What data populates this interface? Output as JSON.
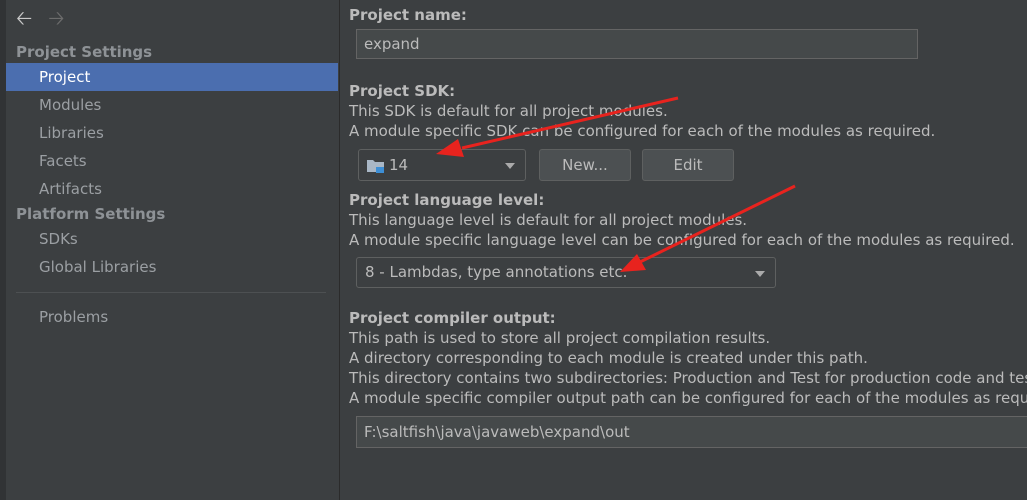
{
  "nav": {
    "back_icon": "arrow-left-icon",
    "forward_icon": "arrow-right-icon"
  },
  "sidebar": {
    "project_settings_header": "Project Settings",
    "platform_settings_header": "Platform Settings",
    "items": [
      {
        "label": "Project",
        "selected": true
      },
      {
        "label": "Modules"
      },
      {
        "label": "Libraries"
      },
      {
        "label": "Facets"
      },
      {
        "label": "Artifacts"
      },
      {
        "label": "SDKs"
      },
      {
        "label": "Global Libraries"
      },
      {
        "label": "Problems"
      }
    ]
  },
  "main": {
    "project_name": {
      "label": "Project name:",
      "value": "expand"
    },
    "project_sdk": {
      "label": "Project SDK:",
      "desc1": "This SDK is default for all project modules.",
      "desc2": "A module specific SDK can be configured for each of the modules as required.",
      "selected": "14",
      "new_button": "New...",
      "edit_button": "Edit"
    },
    "language_level": {
      "label": "Project language level:",
      "desc1": "This language level is default for all project modules.",
      "desc2": "A module specific language level can be configured for each of the modules as required.",
      "selected": "8 - Lambdas, type annotations etc."
    },
    "compiler_output": {
      "label": "Project compiler output:",
      "desc1": "This path is used to store all project compilation results.",
      "desc2": "A directory corresponding to each module is created under this path.",
      "desc3": "This directory contains two subdirectories: Production and Test for production code and test",
      "desc4": "A module specific compiler output path can be configured for each of the modules as require",
      "value": "F:\\saltfish\\java\\javaweb\\expand\\out"
    }
  },
  "colors": {
    "background": "#3c3f41",
    "selection": "#4b6eaf",
    "annotation_arrow": "#e8231e"
  }
}
